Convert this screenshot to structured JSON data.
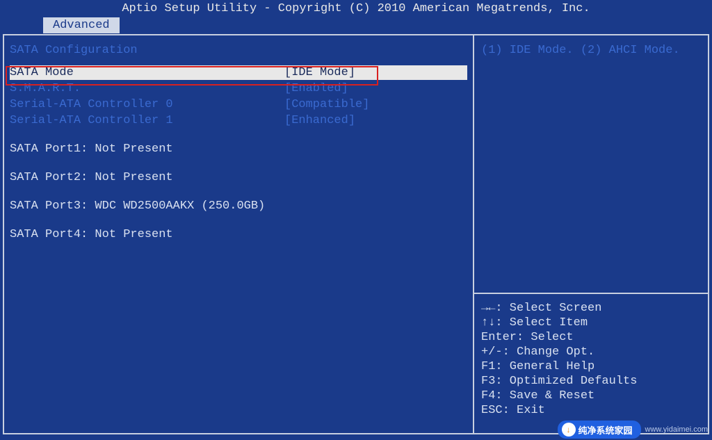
{
  "title": "Aptio Setup Utility - Copyright (C) 2010 American Megatrends, Inc.",
  "tab": "Advanced",
  "section_title": "SATA Configuration",
  "settings": [
    {
      "label": "SATA Mode",
      "value": "[IDE Mode]",
      "highlighted": true
    },
    {
      "label": "S.M.A.R.T.",
      "value": "[Enabled]",
      "highlighted": false
    },
    {
      "label": "Serial-ATA Controller 0",
      "value": "[Compatible]",
      "highlighted": false
    },
    {
      "label": "Serial-ATA Controller 1",
      "value": "[Enhanced]",
      "highlighted": false
    }
  ],
  "ports": [
    "SATA Port1: Not Present",
    "SATA Port2: Not Present",
    "SATA Port3: WDC WD2500AAKX (250.0GB)",
    "SATA Port4: Not Present"
  ],
  "help_text": "(1) IDE Mode. (2) AHCI Mode.",
  "nav": [
    "→←: Select Screen",
    "↑↓: Select Item",
    "Enter: Select",
    "+/-: Change Opt.",
    "F1: General Help",
    "F3: Optimized Defaults",
    "F4: Save & Reset",
    "ESC: Exit"
  ],
  "watermark": {
    "badge": "纯净系统家园",
    "url": "www.yidaimei.com"
  }
}
